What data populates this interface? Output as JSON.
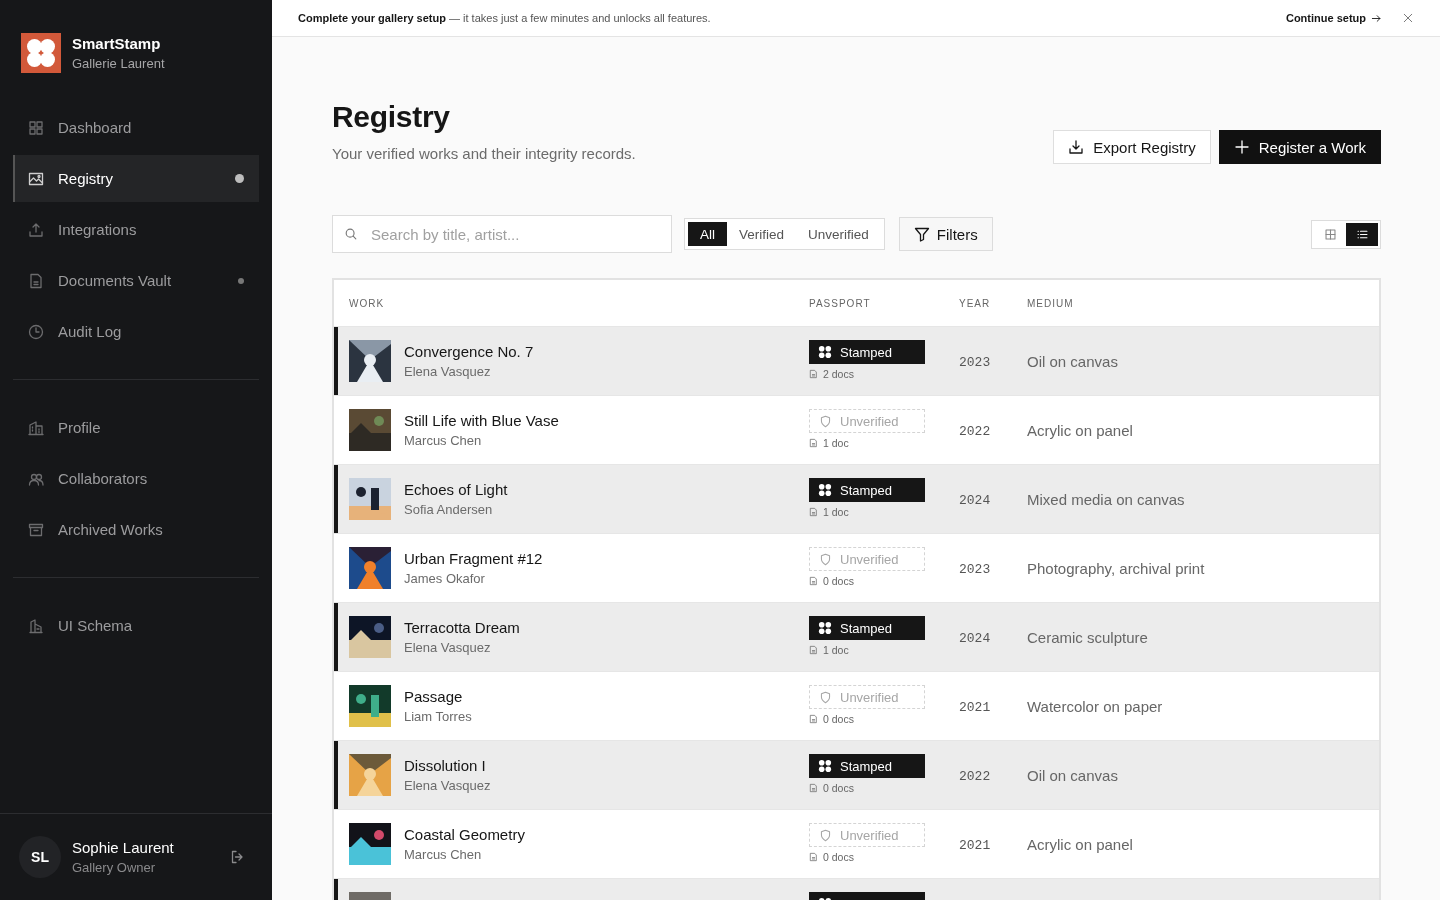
{
  "brand": {
    "name": "SmartStamp",
    "subtitle": "Gallerie Laurent"
  },
  "sidebar": {
    "groups": [
      {
        "items": [
          {
            "label": "Dashboard",
            "selected": false,
            "dot": false
          },
          {
            "label": "Registry",
            "selected": true,
            "dot": true
          },
          {
            "label": "Integrations",
            "selected": false,
            "dot": false
          },
          {
            "label": "Documents Vault",
            "selected": false,
            "dot": true
          },
          {
            "label": "Audit Log",
            "selected": false,
            "dot": false
          }
        ]
      },
      {
        "items": [
          {
            "label": "Profile",
            "selected": false,
            "dot": false
          },
          {
            "label": "Collaborators",
            "selected": false,
            "dot": false
          },
          {
            "label": "Archived Works",
            "selected": false,
            "dot": false
          }
        ]
      },
      {
        "items": [
          {
            "label": "UI Schema",
            "selected": false,
            "dot": false
          }
        ]
      }
    ]
  },
  "user": {
    "initials": "SL",
    "name": "Sophie Laurent",
    "role": "Gallery Owner"
  },
  "banner": {
    "text": "**Complete your gallery setup** — it takes just a few minutes and unlocks all features.",
    "action": "Continue setup"
  },
  "page": {
    "title": "Registry",
    "subtitle": "Your verified works and their integrity records."
  },
  "buttons": [
    {
      "label": "Export Registry",
      "kind": "secondary"
    },
    {
      "label": "Register a Work",
      "kind": "primary"
    }
  ],
  "search": {
    "placeholder": "Search by title, artist..."
  },
  "filter_tabs": [
    {
      "label": "All",
      "selected": true
    },
    {
      "label": "Verified",
      "selected": false
    },
    {
      "label": "Unverified",
      "selected": false
    }
  ],
  "filters_button": "Filters",
  "view_toggle": [
    {
      "kind": "grid",
      "selected": false
    },
    {
      "kind": "list",
      "selected": true
    }
  ],
  "table": {
    "columns": [
      "WORK",
      "PASSPORT",
      "YEAR",
      "MEDIUM"
    ],
    "rows": [
      {
        "title": "Convergence No. 7",
        "artist": "Elena Vasquez",
        "stamped": true,
        "passport": "Stamped",
        "docs": "2 docs",
        "year": "2023",
        "medium": "Oil on canvas"
      },
      {
        "title": "Still Life with Blue Vase",
        "artist": "Marcus Chen",
        "stamped": false,
        "passport": "Unverified",
        "docs": "1 doc",
        "year": "2022",
        "medium": "Acrylic on panel"
      },
      {
        "title": "Echoes of Light",
        "artist": "Sofia Andersen",
        "stamped": true,
        "passport": "Stamped",
        "docs": "1 doc",
        "year": "2024",
        "medium": "Mixed media on canvas"
      },
      {
        "title": "Urban Fragment #12",
        "artist": "James Okafor",
        "stamped": false,
        "passport": "Unverified",
        "docs": "0 docs",
        "year": "2023",
        "medium": "Photography, archival print"
      },
      {
        "title": "Terracotta Dream",
        "artist": "Elena Vasquez",
        "stamped": true,
        "passport": "Stamped",
        "docs": "1 doc",
        "year": "2024",
        "medium": "Ceramic sculpture"
      },
      {
        "title": "Passage",
        "artist": "Liam Torres",
        "stamped": false,
        "passport": "Unverified",
        "docs": "0 docs",
        "year": "2021",
        "medium": "Watercolor on paper"
      },
      {
        "title": "Dissolution I",
        "artist": "Elena Vasquez",
        "stamped": true,
        "passport": "Stamped",
        "docs": "0 docs",
        "year": "2022",
        "medium": "Oil on canvas"
      },
      {
        "title": "Coastal Geometry",
        "artist": "Marcus Chen",
        "stamped": false,
        "passport": "Unverified",
        "docs": "0 docs",
        "year": "2021",
        "medium": "Acrylic on panel"
      },
      {
        "stamped": true
      }
    ]
  }
}
